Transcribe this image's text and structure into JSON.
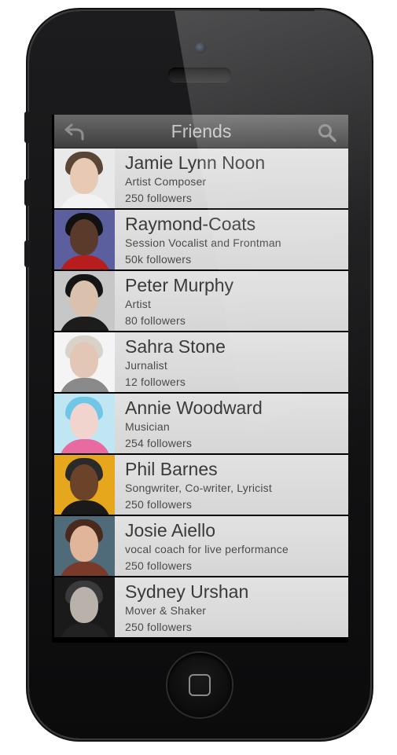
{
  "navbar": {
    "title": "Friends",
    "back_icon": "back-arrow-icon",
    "search_icon": "search-icon"
  },
  "friends": [
    {
      "name": "Jamie Lynn Noon",
      "role": "Artist Composer",
      "followers": "250 followers",
      "avatar": {
        "bg": "#e9e9ea",
        "face": "#e8c9b4",
        "hair": "#5b4636",
        "body": "#f2f2f2"
      }
    },
    {
      "name": "Raymond-Coats",
      "role": "Session Vocalist and Frontman",
      "followers": "50k followers",
      "avatar": {
        "bg": "#5b5f9e",
        "face": "#5a3a2a",
        "hair": "#111111",
        "body": "#b81d1d"
      }
    },
    {
      "name": "Peter Murphy",
      "role": "Artist",
      "followers": "80 followers",
      "avatar": {
        "bg": "#c7c7c7",
        "face": "#d9c1ad",
        "hair": "#151515",
        "body": "#1c1c1c"
      }
    },
    {
      "name": "Sahra Stone",
      "role": "Jurnalist",
      "followers": "12 followers",
      "avatar": {
        "bg": "#f4f4f4",
        "face": "#e2c7b6",
        "hair": "#d8d2c8",
        "body": "#8a8a8a"
      }
    },
    {
      "name": "Annie Woodward",
      "role": "Musician",
      "followers": "254 followers",
      "avatar": {
        "bg": "#bfe6f2",
        "face": "#f2d4cf",
        "hair": "#6fc6e6",
        "body": "#e86aa0"
      }
    },
    {
      "name": "Phil Barnes",
      "role": "Songwriter, Co-writer, Lyricist",
      "followers": "250 followers",
      "avatar": {
        "bg": "#e7a71c",
        "face": "#6b4328",
        "hair": "#2a2a2a",
        "body": "#1a1a1a"
      }
    },
    {
      "name": "Josie Aiello",
      "role": "vocal coach for live performance",
      "followers": "250 followers",
      "avatar": {
        "bg": "#4f6b7a",
        "face": "#e0b59a",
        "hair": "#4a2a1c",
        "body": "#7a3a2a"
      }
    },
    {
      "name": "Sydney Urshan",
      "role": "Mover & Shaker",
      "followers": "250 followers",
      "avatar": {
        "bg": "#1a1a1a",
        "face": "#b9b2ab",
        "hair": "#3a3a3a",
        "body": "#222222"
      }
    }
  ]
}
